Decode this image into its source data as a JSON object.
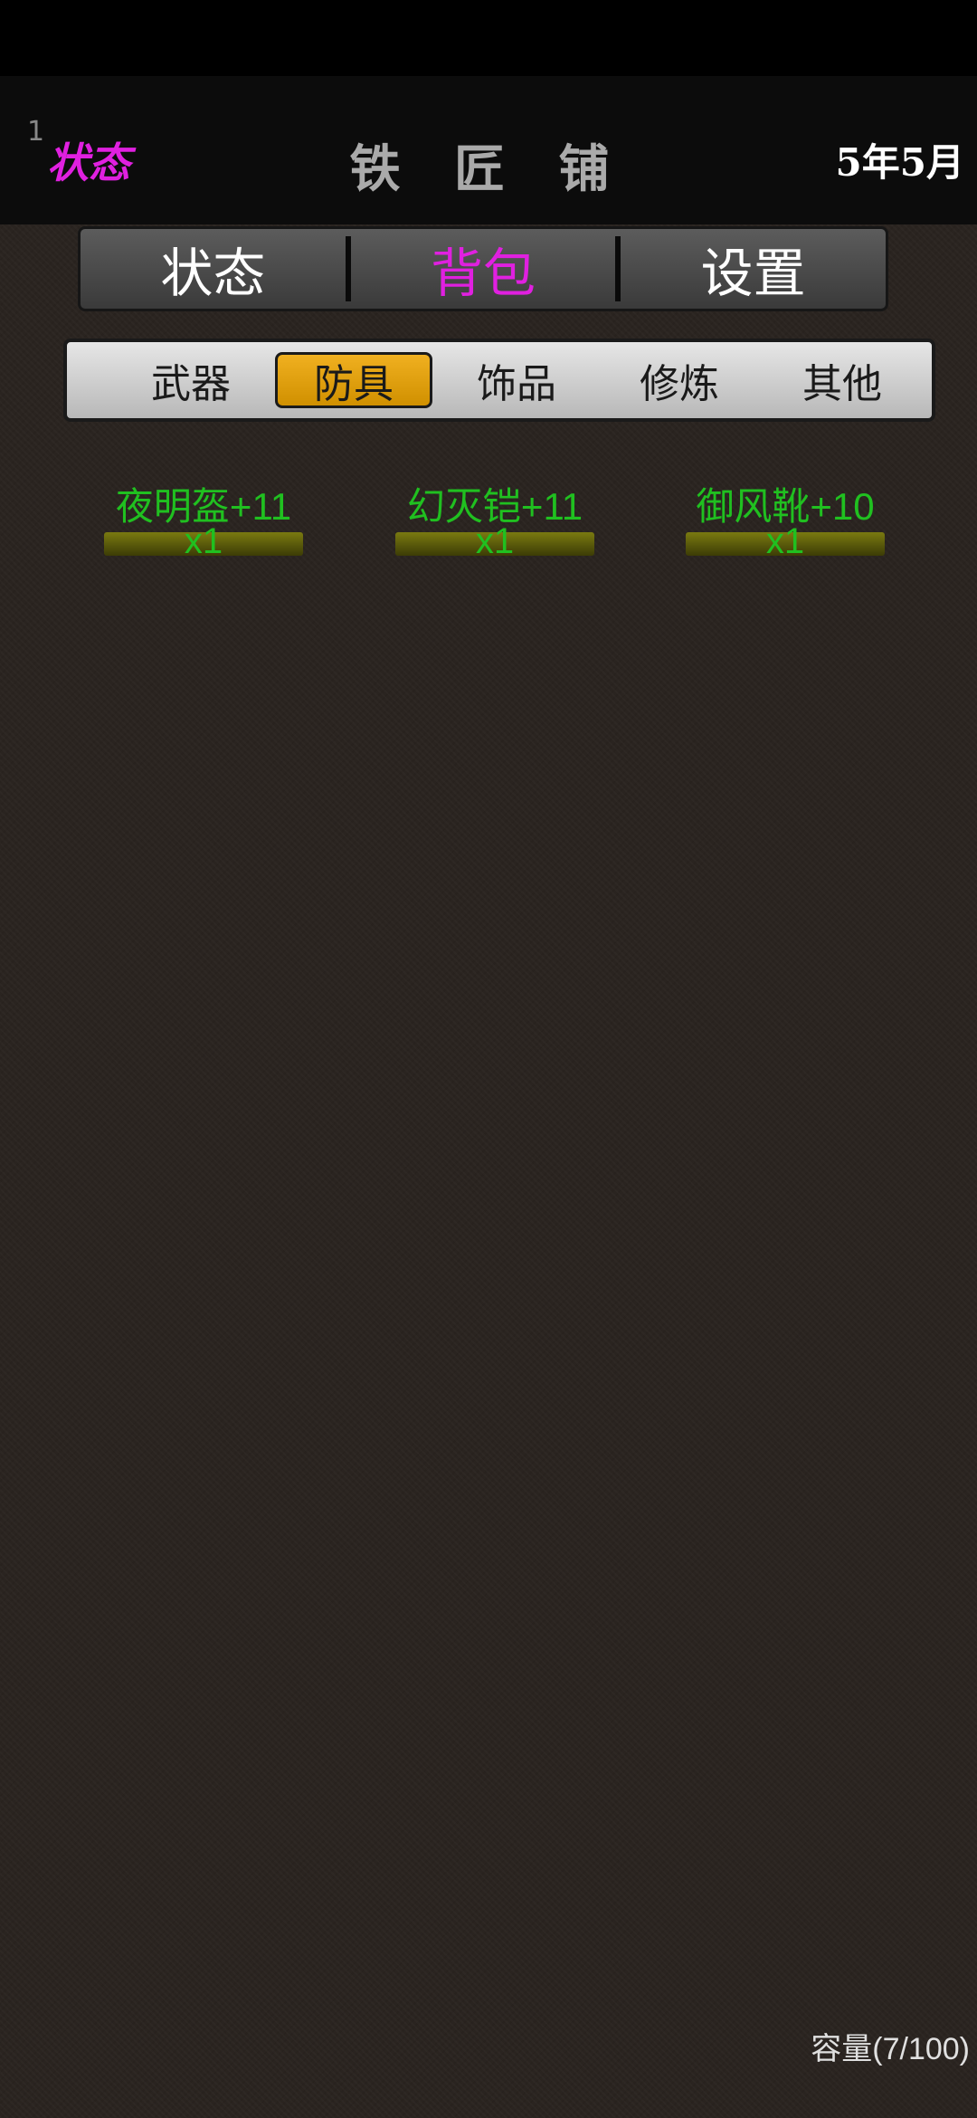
{
  "header": {
    "number": "1",
    "status_label": "状态",
    "title": "铁 匠 铺",
    "date": "5年5月"
  },
  "main_tabs": [
    {
      "label": "状态",
      "active": false
    },
    {
      "label": "背包",
      "active": true
    },
    {
      "label": "设置",
      "active": false
    }
  ],
  "sub_tabs": [
    {
      "label": "武器",
      "active": false
    },
    {
      "label": "防具",
      "active": true
    },
    {
      "label": "饰品",
      "active": false
    },
    {
      "label": "修炼",
      "active": false
    },
    {
      "label": "其他",
      "active": false
    }
  ],
  "items": [
    {
      "name": "夜明盔+11",
      "count": "x1"
    },
    {
      "name": "幻灭铠+11",
      "count": "x1"
    },
    {
      "name": "御风靴+10",
      "count": "x1"
    }
  ],
  "capacity": "容量(7/100)",
  "colors": {
    "accent_magenta": "#e020e0",
    "item_green": "#20c020",
    "active_subtab_gold": "#d09000",
    "background": "#2a2420"
  }
}
